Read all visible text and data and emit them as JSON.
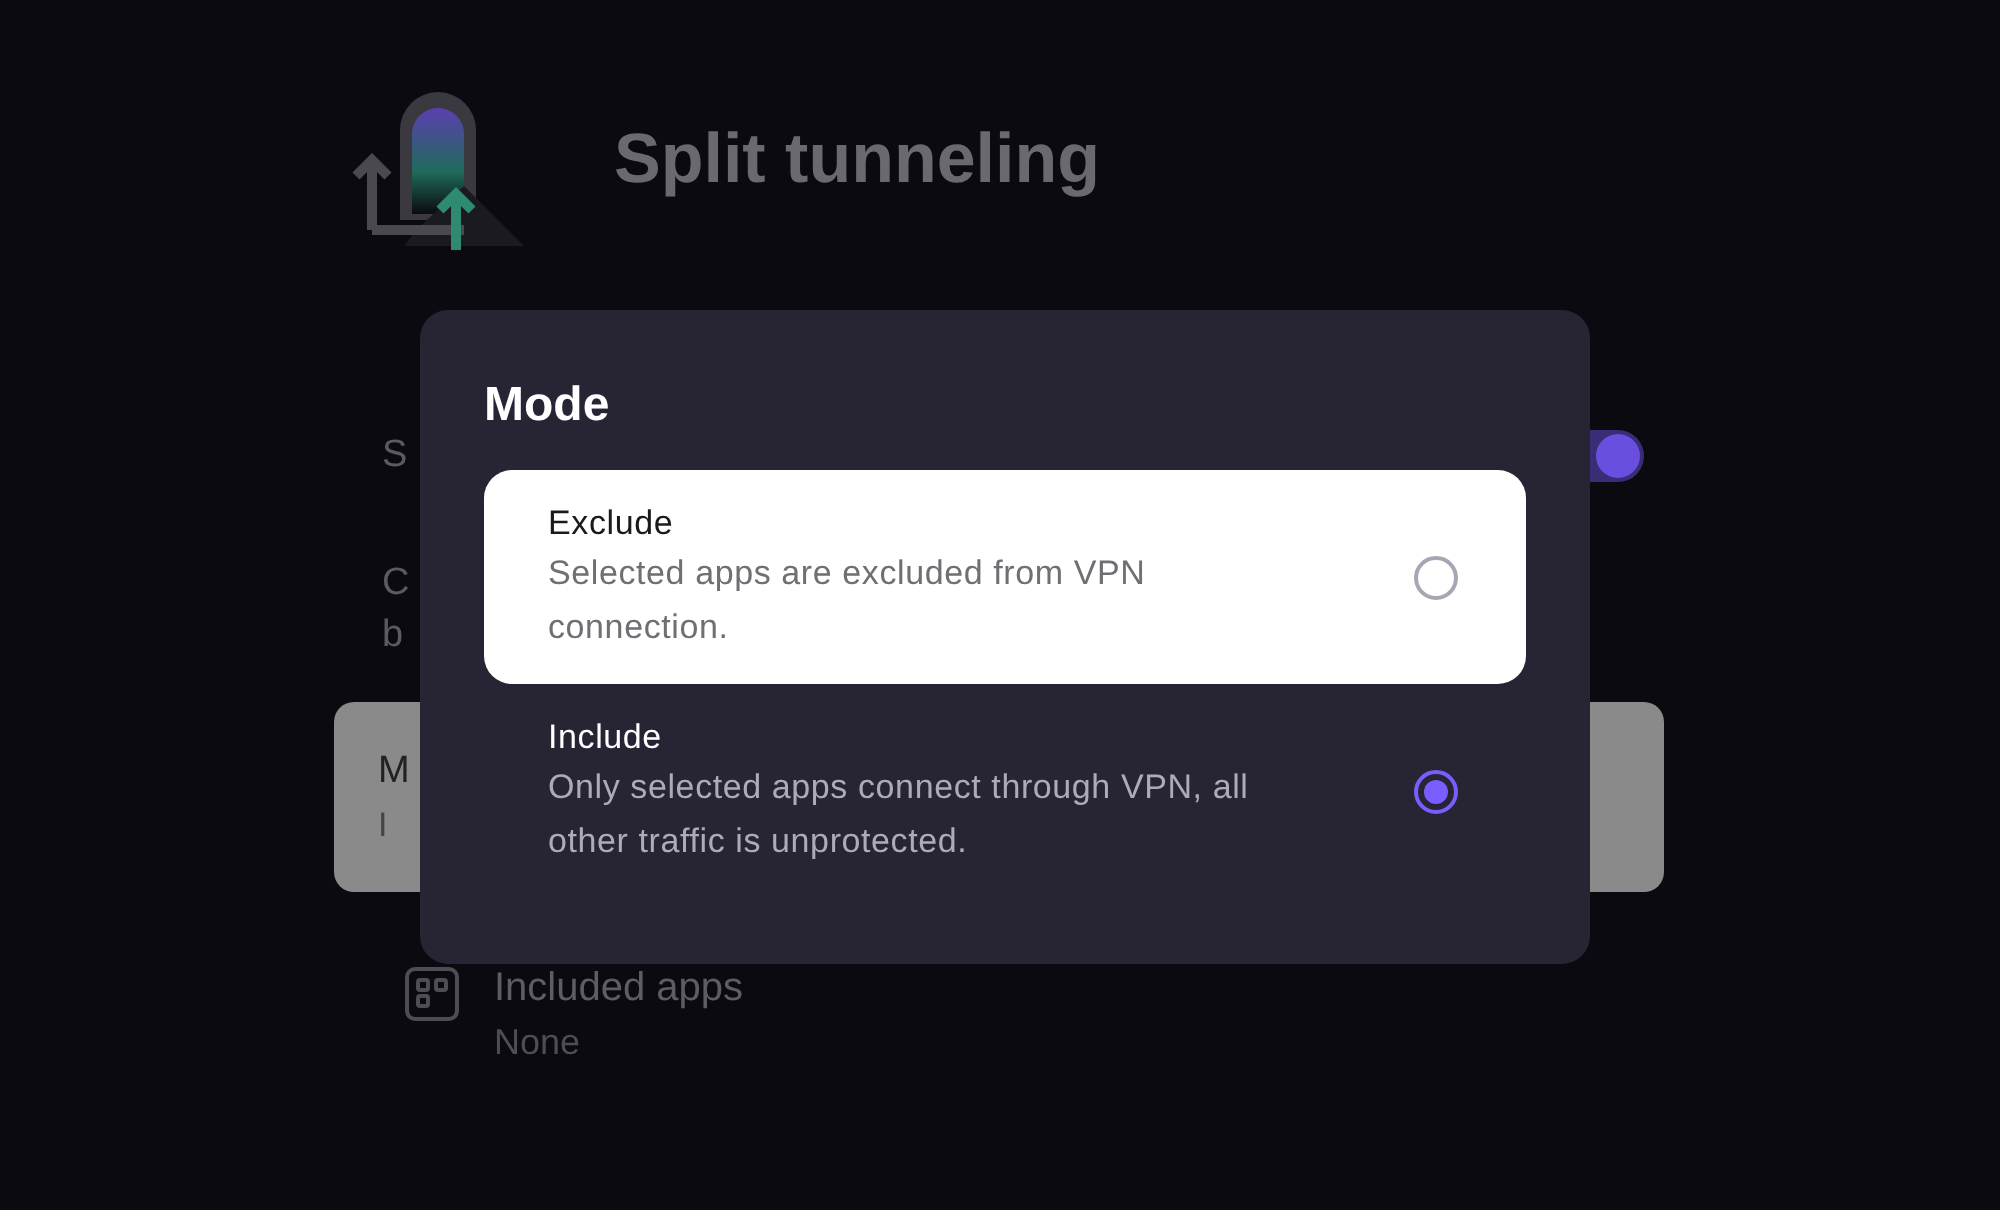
{
  "page": {
    "title": "Split tunneling"
  },
  "settings": {
    "toggle_row": {
      "label": "S",
      "on": true
    },
    "description_lines": [
      "C",
      "b"
    ],
    "mode_card": {
      "title": "M",
      "value": "I"
    },
    "apps_row": {
      "label": "Included apps",
      "value": "None"
    }
  },
  "dialog": {
    "title": "Mode",
    "options": [
      {
        "label": "Exclude",
        "description": "Selected apps are excluded from VPN connection.",
        "selected": false,
        "focused": true
      },
      {
        "label": "Include",
        "description": "Only selected apps connect through VPN, all other traffic is unprotected.",
        "selected": true,
        "focused": false
      }
    ]
  }
}
